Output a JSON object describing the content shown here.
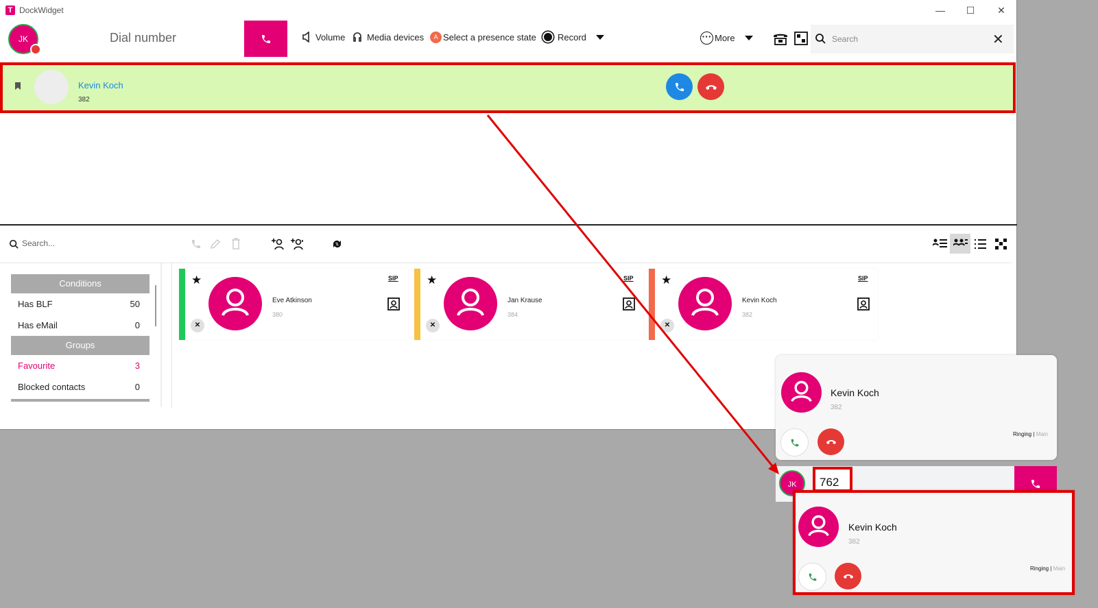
{
  "window": {
    "title": "DockWidget",
    "logo": "T"
  },
  "user": {
    "initials": "JK"
  },
  "toolbar": {
    "dial_placeholder": "Dial number",
    "volume": "Volume",
    "media_devices": "Media devices",
    "presence": "Select a presence state",
    "record": "Record",
    "more": "More",
    "search_placeholder": "Search"
  },
  "active_call": {
    "name": "Kevin Koch",
    "number": "382"
  },
  "contacts_toolbar": {
    "search_placeholder": "Search..."
  },
  "conditions": {
    "header": "Conditions",
    "items": [
      {
        "label": "Has BLF",
        "count": "50"
      },
      {
        "label": "Has eMail",
        "count": "0"
      }
    ]
  },
  "groups": {
    "header": "Groups",
    "items": [
      {
        "label": "Favourite",
        "count": "3"
      },
      {
        "label": "Blocked contacts",
        "count": "0"
      }
    ]
  },
  "contacts": [
    {
      "name": "Eve Atkinson",
      "number": "380",
      "sip": "SIP",
      "status_color": "#1ec95a"
    },
    {
      "name": "Jan Krause",
      "number": "384",
      "sip": "SIP",
      "status_color": "#f5c242"
    },
    {
      "name": "Kevin Koch",
      "number": "382",
      "sip": "SIP",
      "status_color": "#f26a4b"
    }
  ],
  "popup_upper": {
    "name": "Kevin Koch",
    "number": "382",
    "status": "Ringing",
    "line": "Main"
  },
  "mini_dialer": {
    "initials": "JK",
    "value": "762"
  },
  "popup_lower": {
    "name": "Kevin Koch",
    "number": "382",
    "status": "Ringing",
    "line": "Main"
  },
  "colors": {
    "brand": "#e20074",
    "highlight": "#e00000",
    "call_active_bg": "#d8f8b4",
    "accept": "#1e88e5",
    "reject": "#e53935"
  }
}
